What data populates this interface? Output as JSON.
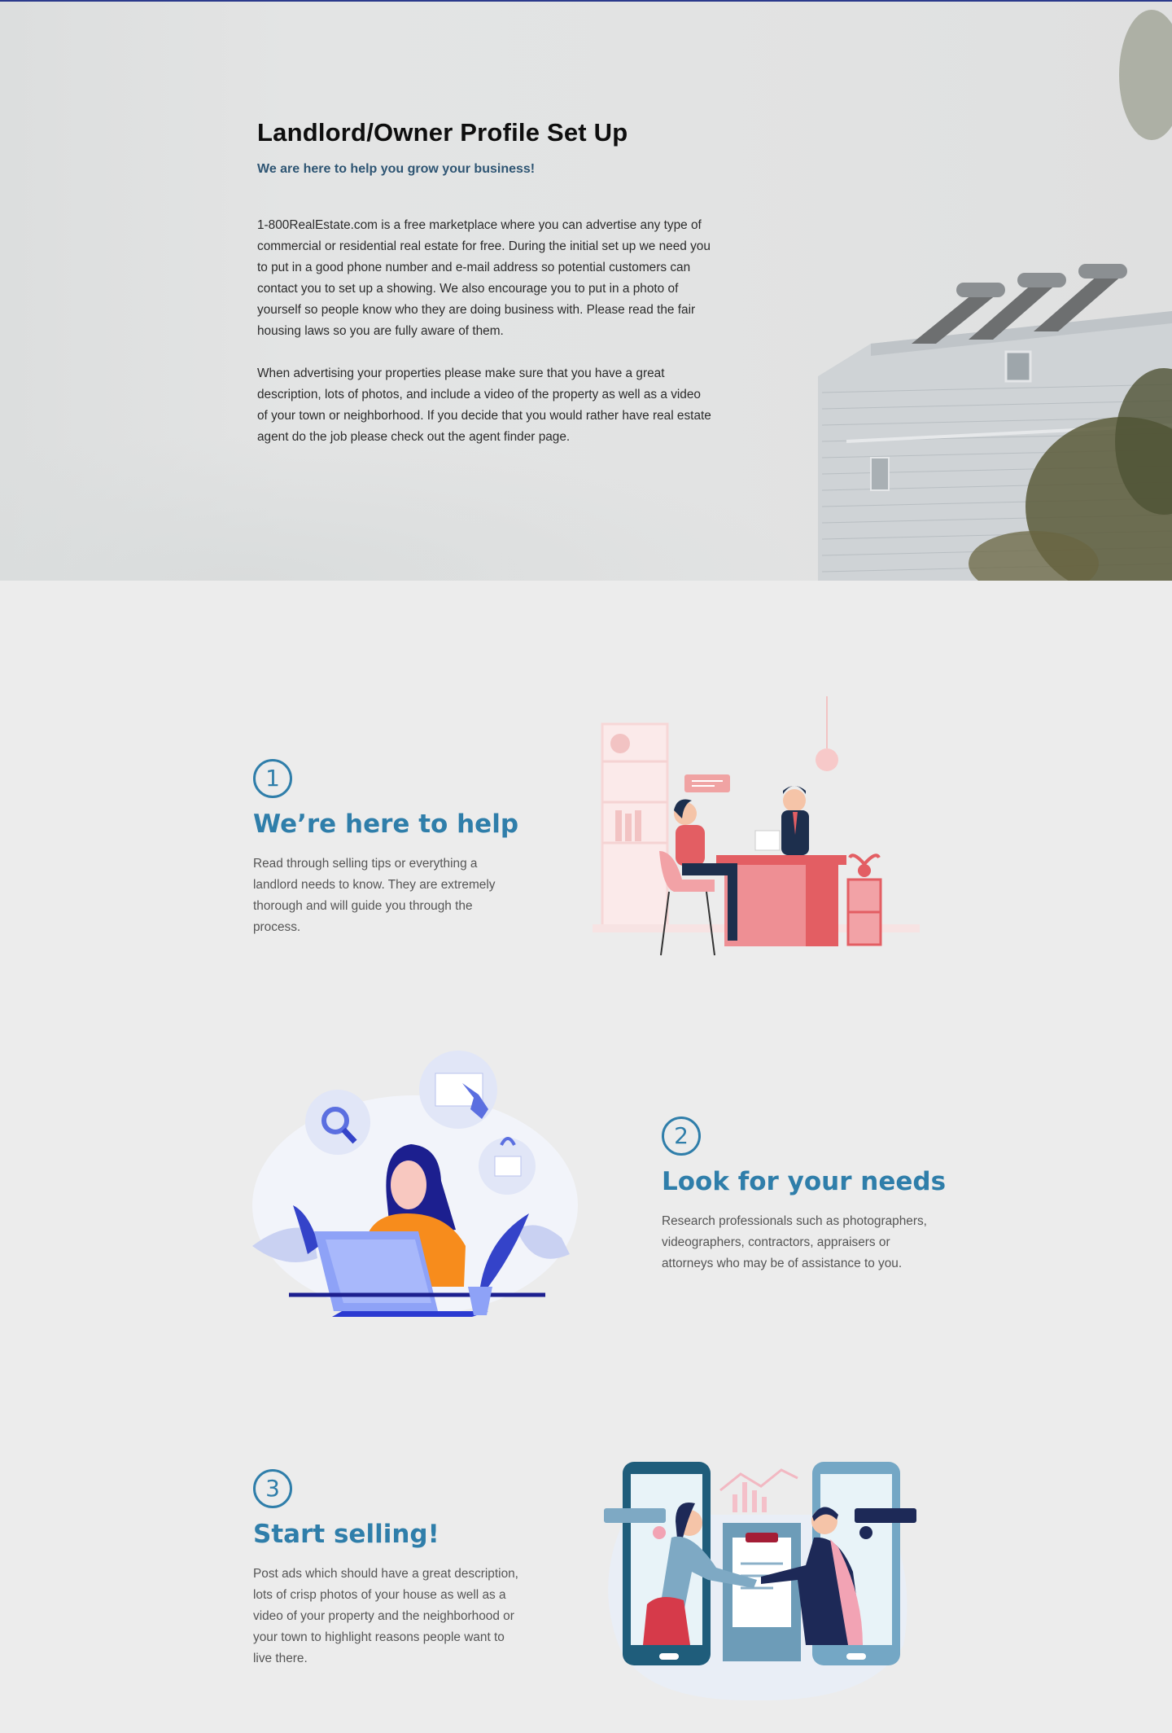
{
  "hero": {
    "title": "Landlord/Owner Profile Set Up",
    "subtitle": "We are here to help you grow your business!",
    "paragraph1": "1-800RealEstate.com is a free marketplace where you can advertise any type of commercial or residential real estate for free. During the initial set up we need you to put in a good phone number and e-mail address so potential customers can contact you to set up a showing. We also encourage you to put in a photo of yourself so people know who they are doing business with. Please read the fair housing laws so you are fully aware of them.",
    "paragraph2": " When advertising your properties please make sure that you have a great description, lots of photos, and include a video of the property as well as a video of your town or neighborhood. If you decide that you would rather have real estate agent do the job please check out the agent finder page."
  },
  "steps": [
    {
      "number": "1",
      "title": "We’re here to help",
      "text": "Read through selling tips or everything a landlord needs to know. They are extremely thorough and will guide you through the process."
    },
    {
      "number": "2",
      "title": "Look for your needs",
      "text": "Research professionals such as photographers, videographers, contractors, appraisers or attorneys who may be of assistance to you."
    },
    {
      "number": "3",
      "title": "Start selling!",
      "text": "Post ads which should have a great description, lots of crisp photos of your house as well as a video of your property and the neighborhood or your town to highlight reasons people want to live there."
    }
  ],
  "colors": {
    "accent": "#2f7eaa",
    "subtitle": "#2e5573",
    "top_line": "#2b3a8c"
  },
  "icons": [
    "building-photo",
    "office-meeting-illustration",
    "laptop-search-illustration",
    "phone-handshake-illustration"
  ]
}
